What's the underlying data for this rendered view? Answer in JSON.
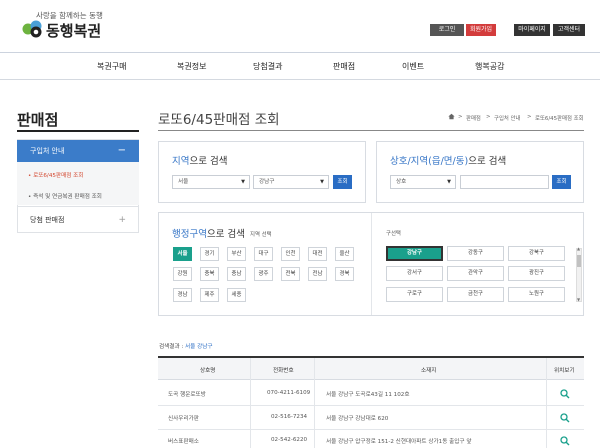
{
  "header": {
    "slogan": "사랑을 함께하는 동행",
    "brand": "동행복권",
    "util": [
      "로그인",
      "회원가입",
      "마이페이지",
      "고객센터"
    ]
  },
  "gnb": [
    "복권구매",
    "복권정보",
    "당첨결과",
    "판매점",
    "이벤트",
    "행복공감"
  ],
  "lnb": {
    "title": "판매점",
    "active": "구입처 안내",
    "active_toggle": "−",
    "sub": [
      "로또6/45판매점 조회",
      "즉석 및 연금복권 판매점 조회"
    ],
    "item2": "당첨 판매점",
    "item2_toggle": "+"
  },
  "page": {
    "title": "로또6/45판매점 조회",
    "breadcrumb": [
      "판매점",
      "구입처 안내",
      "로또6/45판매점 조회"
    ]
  },
  "region_search": {
    "title_hl": "지역",
    "title_rest": "으로 검색",
    "sido": "서울",
    "sigungu": "강남구",
    "button": "조회"
  },
  "name_search": {
    "title_hl": "상호/지역(읍/면/동)",
    "title_rest": "으로 검색",
    "select": "상호",
    "input": "",
    "button": "조회"
  },
  "admin_search": {
    "title_hl": "행정구역",
    "title_rest": "으로 검색",
    "sub_label": "지역 선택",
    "cities": [
      "서울",
      "경기",
      "부산",
      "대구",
      "인천",
      "대전",
      "울산",
      "강원",
      "충북",
      "충남",
      "광주",
      "전북",
      "전남",
      "경북",
      "경남",
      "제주",
      "세종"
    ],
    "gu_label": "구선택",
    "gus": [
      "강남구",
      "강동구",
      "강북구",
      "강서구",
      "관악구",
      "광진구",
      "구로구",
      "금천구",
      "노원구"
    ]
  },
  "results": {
    "label": "검색결과 : ",
    "label_hl": "서울 강남구",
    "headers": [
      "상호명",
      "전화번호",
      "소재지",
      "위치보기"
    ],
    "rows": [
      {
        "name": "도곡 행운로또방",
        "phone": "070-4211-6109",
        "addr": "서울 강남구 도곡로43길 11 102호"
      },
      {
        "name": "신사우리가판",
        "phone": "02-516-7234",
        "addr": "서울 강남구 강남대로 620"
      },
      {
        "name": "버스표판매소",
        "phone": "02-542-6220",
        "addr": "서울 강남구 압구정로 151-2 신현대아파트 상가1동 출입구 앞"
      }
    ]
  },
  "colors": {
    "accent": "#3474c6",
    "teal": "#1aa08c",
    "lnb_active": "#3b7cc9"
  }
}
